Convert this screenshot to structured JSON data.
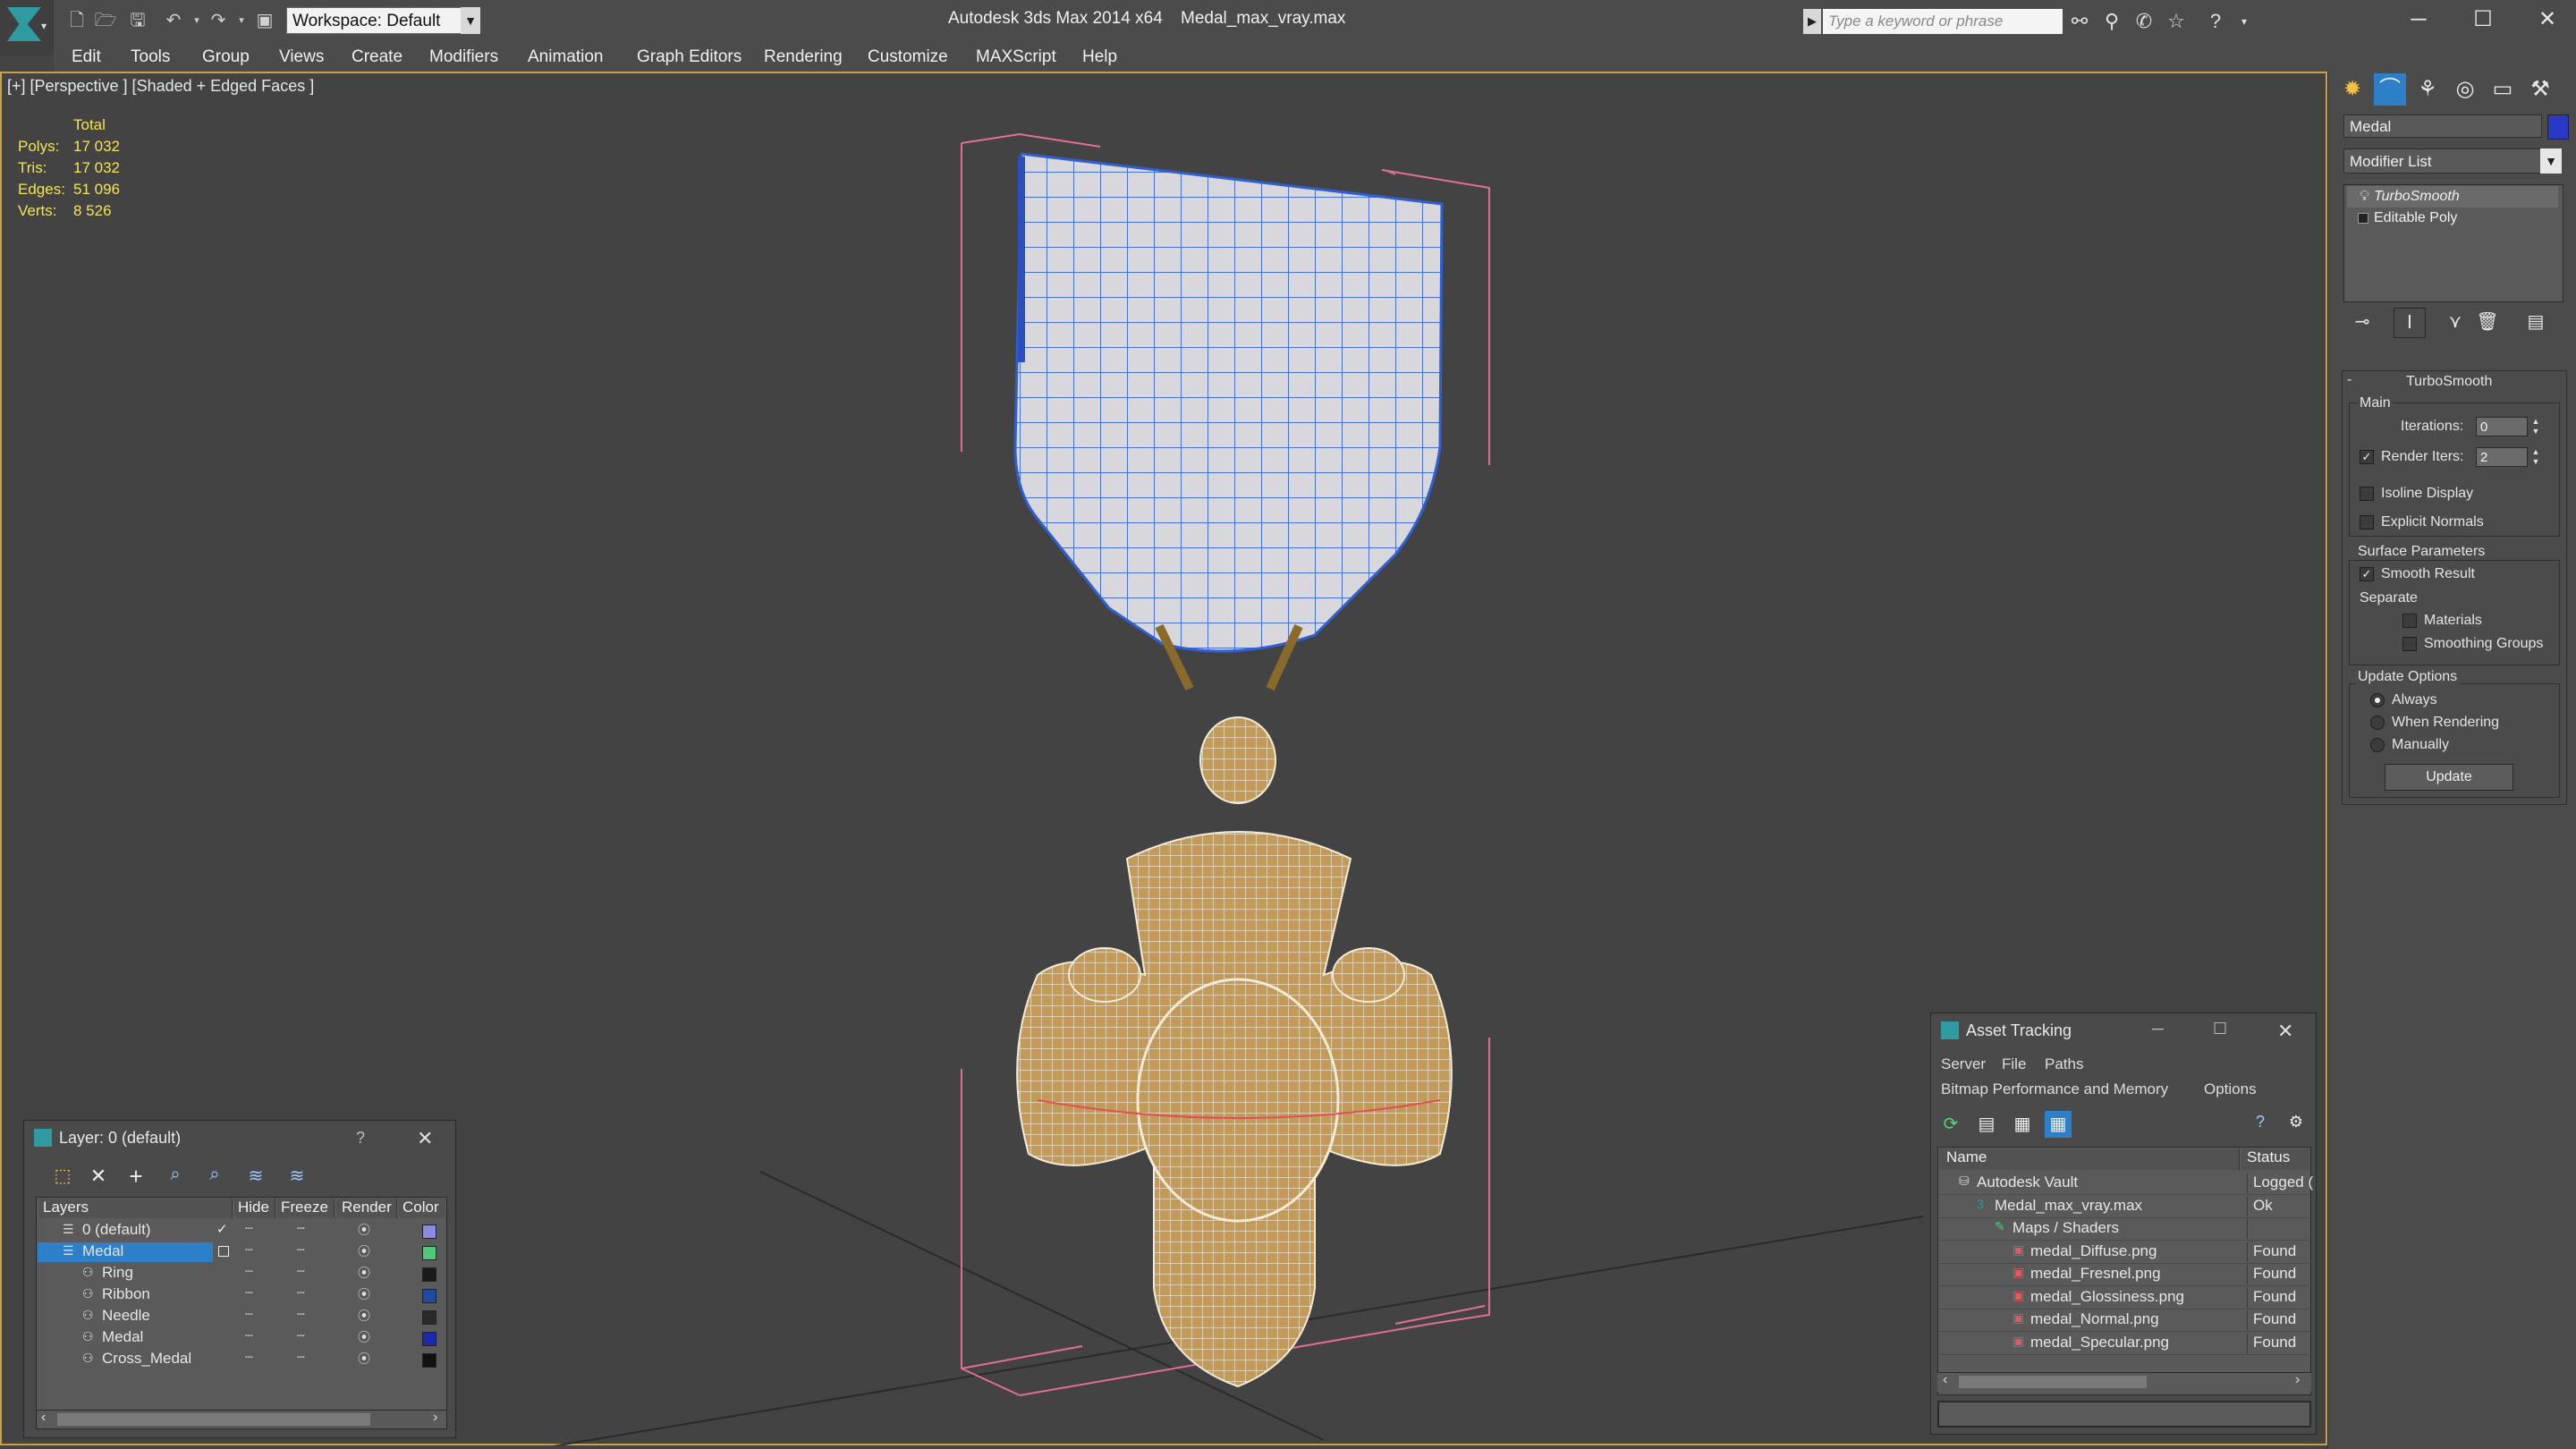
{
  "app": {
    "title": "Autodesk 3ds Max  2014 x64",
    "file": "Medal_max_vray.max",
    "workspace": "Workspace: Default",
    "search_placeholder": "Type a keyword or phrase"
  },
  "menu": [
    "Edit",
    "Tools",
    "Group",
    "Views",
    "Create",
    "Modifiers",
    "Animation",
    "Graph Editors",
    "Rendering",
    "Customize",
    "MAXScript",
    "Help"
  ],
  "viewport": {
    "label": "[+] [Perspective ] [Shaded + Edged Faces ]",
    "stats": {
      "header": "Total",
      "rows": [
        {
          "label": "Polys:",
          "value": "17 032"
        },
        {
          "label": "Tris:",
          "value": "17 032"
        },
        {
          "label": "Edges:",
          "value": "51 096"
        },
        {
          "label": "Verts:",
          "value": "8 526"
        }
      ]
    }
  },
  "command_panel": {
    "object_name": "Medal",
    "object_color": "#2a39c5",
    "modifier_list": "Modifier List",
    "stack": [
      "TurboSmooth",
      "Editable Poly"
    ],
    "turbosmooth": {
      "title": "TurboSmooth",
      "main": "Main",
      "iterations_label": "Iterations:",
      "iterations": "0",
      "render_iters_label": "Render Iters:",
      "render_iters": "2",
      "isoline": "Isoline Display",
      "explicit_normals": "Explicit Normals",
      "surface_params": "Surface Parameters",
      "smooth_result": "Smooth Result",
      "separate": "Separate",
      "materials": "Materials",
      "smoothing_groups": "Smoothing Groups",
      "update_options": "Update Options",
      "always": "Always",
      "when_rendering": "When Rendering",
      "manually": "Manually",
      "update_button": "Update"
    }
  },
  "layer_window": {
    "title": "Layer: 0 (default)",
    "help": "?",
    "columns": [
      "Layers",
      "Hide",
      "Freeze",
      "Render",
      "Color"
    ],
    "rows": [
      {
        "name": "0 (default)",
        "color": "#8a8ae0",
        "indent": 0,
        "selected": false,
        "current": true
      },
      {
        "name": "Medal",
        "color": "#4fc87a",
        "indent": 0,
        "selected": true,
        "current": false
      },
      {
        "name": "Ring",
        "color": "#1a1a1a",
        "indent": 1,
        "selected": false,
        "current": false
      },
      {
        "name": "Ribbon",
        "color": "#1f4aa0",
        "indent": 1,
        "selected": false,
        "current": false
      },
      {
        "name": "Needle",
        "color": "#2a2a2a",
        "indent": 1,
        "selected": false,
        "current": false
      },
      {
        "name": "Medal",
        "color": "#1a2aa8",
        "indent": 1,
        "selected": false,
        "current": false
      },
      {
        "name": "Cross_Medal",
        "color": "#111111",
        "indent": 1,
        "selected": false,
        "current": false
      }
    ]
  },
  "asset_window": {
    "title": "Asset Tracking",
    "menu": [
      "Server",
      "File",
      "Paths"
    ],
    "menu2": [
      "Bitmap Performance and Memory",
      "Options"
    ],
    "columns": [
      "Name",
      "Status"
    ],
    "rows": [
      {
        "name": "Autodesk Vault",
        "status": "Logged (",
        "level": 0,
        "type": "vault"
      },
      {
        "name": "Medal_max_vray.max",
        "status": "Ok",
        "level": 1,
        "type": "max"
      },
      {
        "name": "Maps / Shaders",
        "status": "",
        "level": 2,
        "type": "maps"
      },
      {
        "name": "medal_Diffuse.png",
        "status": "Found",
        "level": 3,
        "type": "png"
      },
      {
        "name": "medal_Fresnel.png",
        "status": "Found",
        "level": 3,
        "type": "png"
      },
      {
        "name": "medal_Glossiness.png",
        "status": "Found",
        "level": 3,
        "type": "png"
      },
      {
        "name": "medal_Normal.png",
        "status": "Found",
        "level": 3,
        "type": "png"
      },
      {
        "name": "medal_Specular.png",
        "status": "Found",
        "level": 3,
        "type": "png"
      }
    ]
  }
}
